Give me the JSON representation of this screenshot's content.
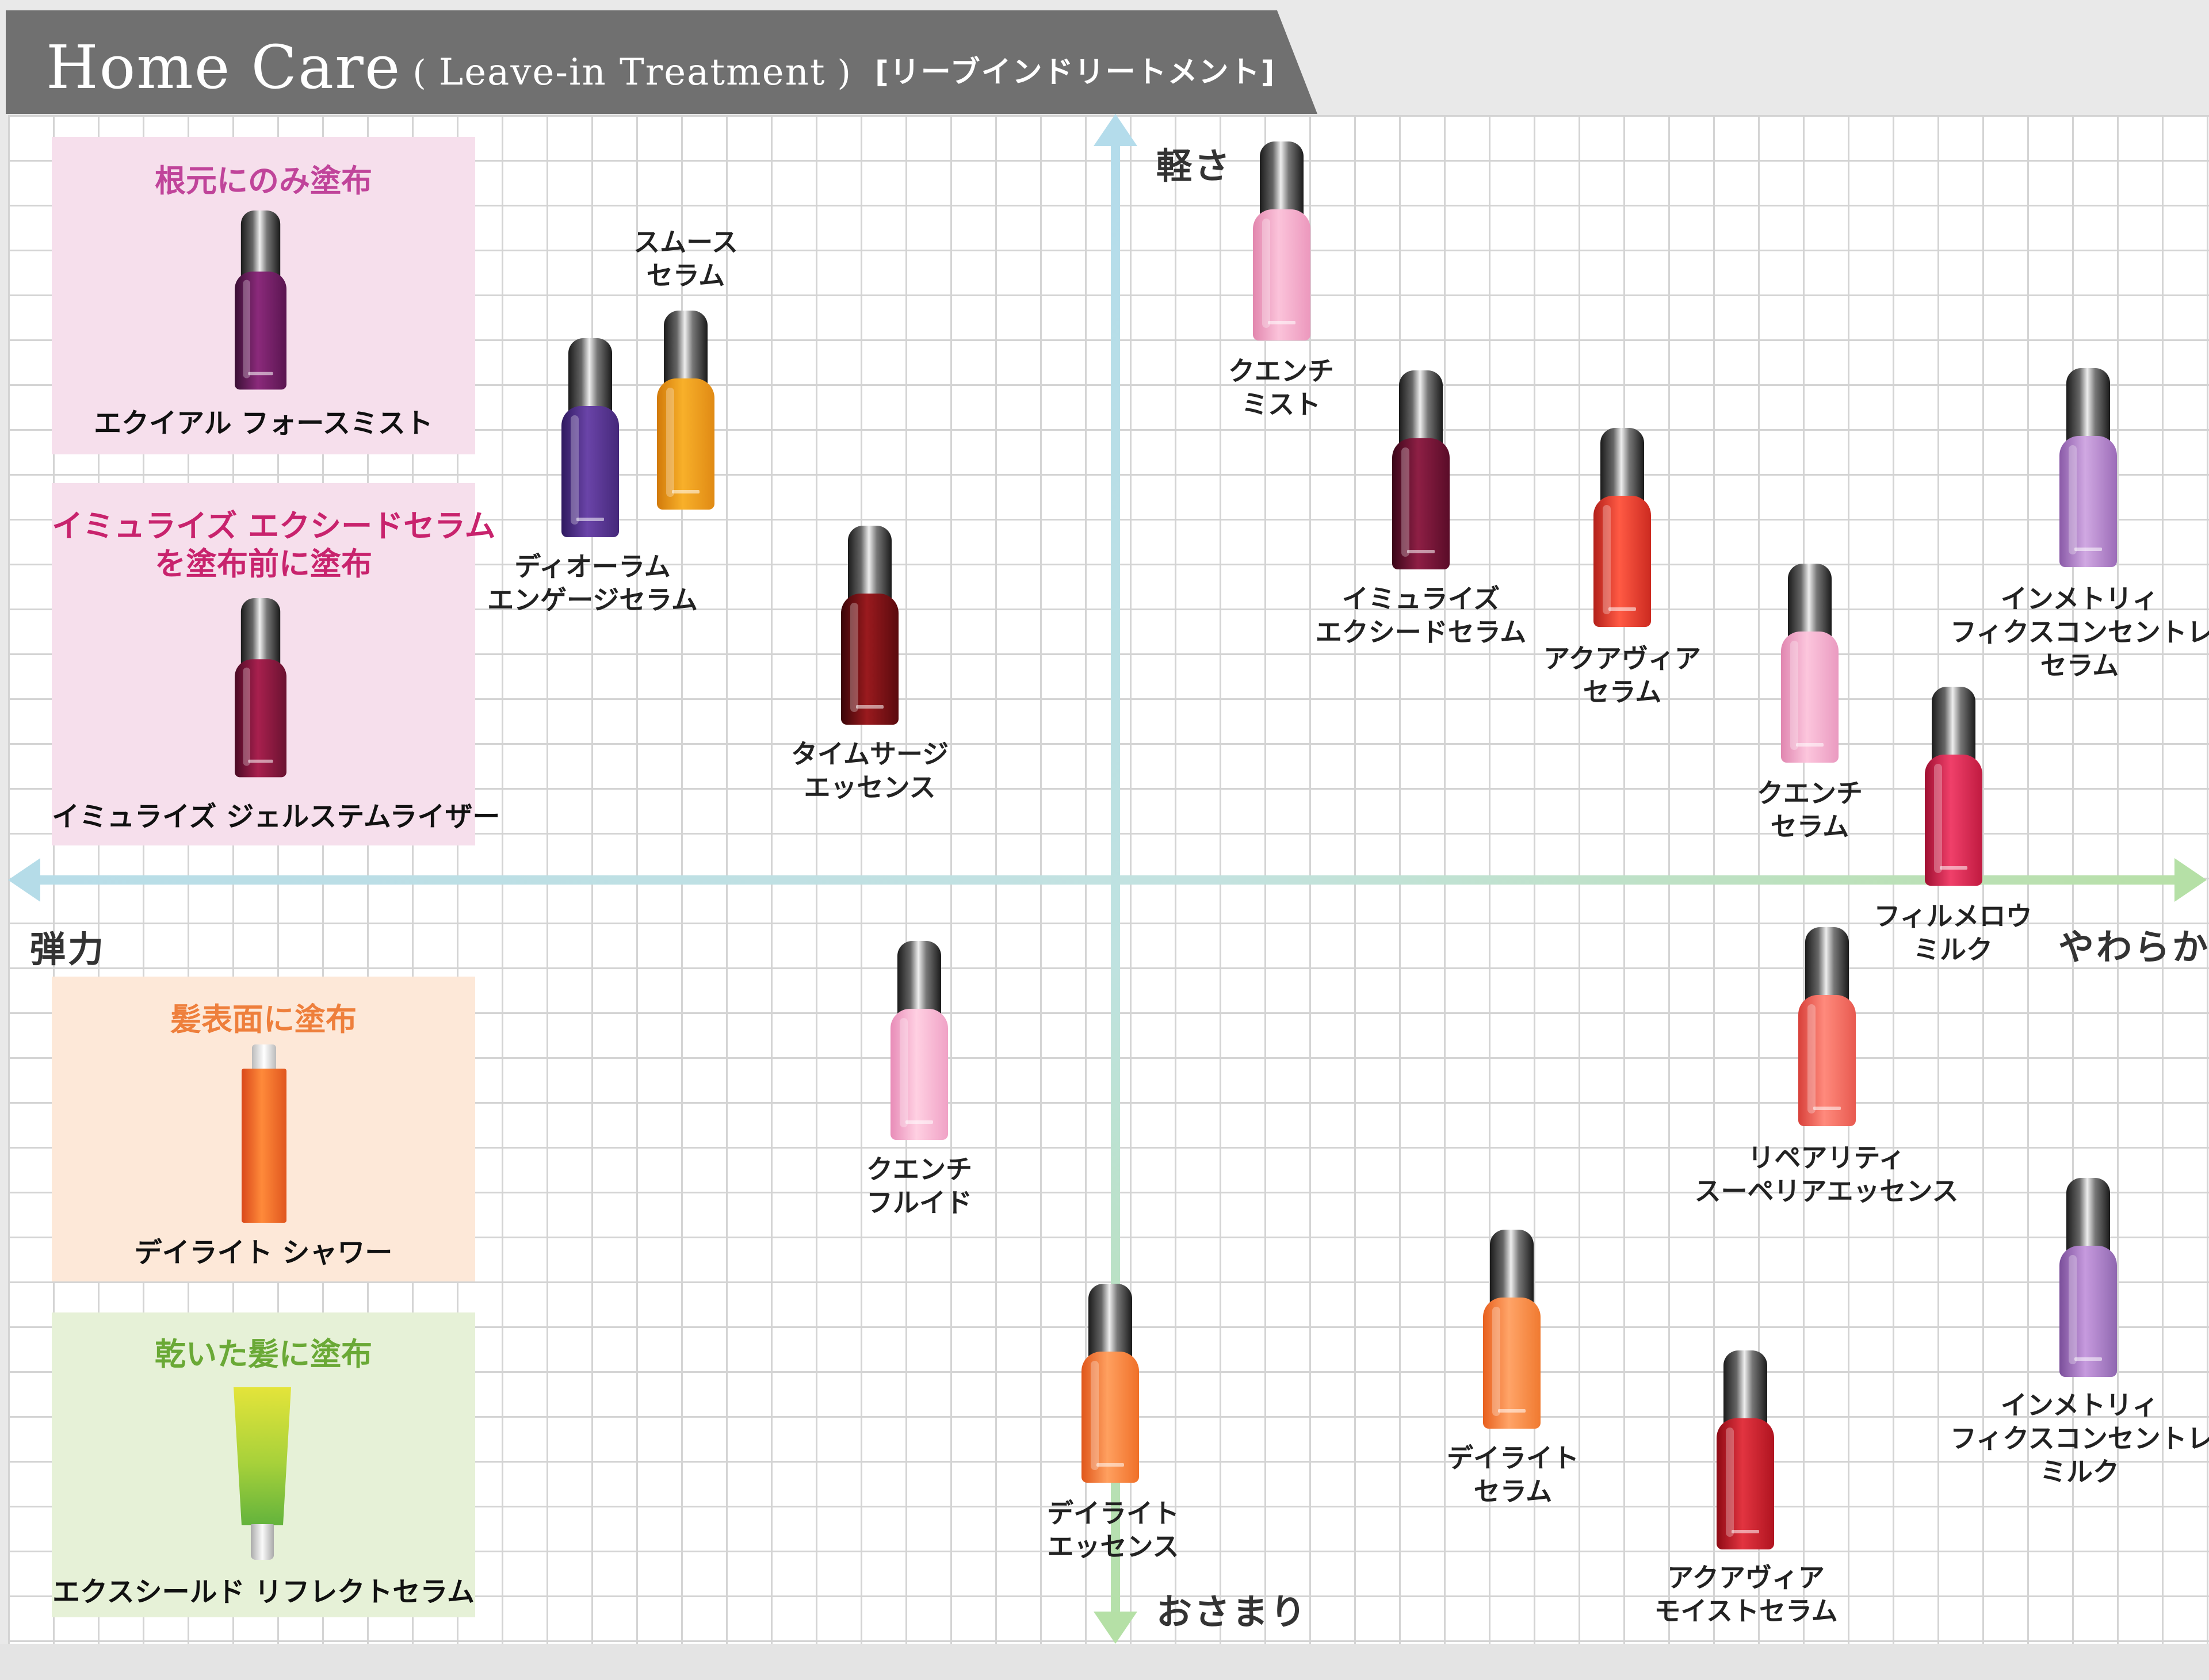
{
  "header": {
    "title": "Home Care",
    "paren_open": "(",
    "subtitle": "Leave-in Treatment",
    "paren_close": ")",
    "subtitle_jp": "[リーブインドリートメント]"
  },
  "axes": {
    "top": "軽さ",
    "bottom": "おさまり",
    "left": "弾力",
    "right": "やわらか"
  },
  "legend": [
    {
      "title": "根元にのみ塗布",
      "title_color": "#c0449a",
      "bg": "#f6dfec",
      "caption": "エクイアル フォースミスト"
    },
    {
      "title_line1": "イミュライズ エクシードセラム",
      "title_line2": "を塗布前に塗布",
      "title_color": "#c8236d",
      "bg": "#f6dfec",
      "caption": "イミュライズ ジェルステムライザー"
    },
    {
      "title": "髪表面に塗布",
      "title_color": "#ee7f3c",
      "bg": "#fde8d8",
      "caption": "デイライト シャワー"
    },
    {
      "title": "乾いた髪に塗布",
      "title_color": "#6aa936",
      "bg": "#e6f1d7",
      "caption": "エクスシールド リフレクトセラム"
    }
  ],
  "products": [
    {
      "lines": [
        "スムース",
        "セラム"
      ],
      "color": "#f2a31e"
    },
    {
      "lines": [
        "ディオーラム",
        "エンゲージセラム"
      ],
      "color": "#5a3590"
    },
    {
      "lines": [
        "タイムサージ",
        "エッセンス"
      ],
      "color": "#7a1015"
    },
    {
      "lines": [
        "クエンチ",
        "ミスト"
      ],
      "color": "#f2a0c4"
    },
    {
      "lines": [
        "イミュライズ",
        "エクシードセラム"
      ],
      "color": "#6e1230"
    },
    {
      "lines": [
        "アクアヴィア",
        "セラム"
      ],
      "color": "#e0392b"
    },
    {
      "lines": [
        "インメトリィ",
        "フィクスコンセントレー",
        "セラム"
      ],
      "color": "#b48ac8"
    },
    {
      "lines": [
        "クエンチ",
        "セラム"
      ],
      "color": "#f3a6c8"
    },
    {
      "lines": [
        "フィルメロウ",
        "ミルク"
      ],
      "color": "#d61e45"
    },
    {
      "lines": [
        "クエンチ",
        "フルイド"
      ],
      "color": "#f5a8c8"
    },
    {
      "lines": [
        "リペアリティ",
        "スーペリアエッセンス"
      ],
      "color": "#ec5a50"
    },
    {
      "lines": [
        "デイライト",
        "エッセンス"
      ],
      "color": "#f5792a"
    },
    {
      "lines": [
        "デイライト",
        "セラム"
      ],
      "color": "#f58030"
    },
    {
      "lines": [
        "アクアヴィア",
        "モイストセラム"
      ],
      "color": "#c81d28"
    },
    {
      "lines": [
        "インメトリィ",
        "フィクスコンセントレー",
        "ミルク"
      ],
      "color": "#a078bc"
    }
  ]
}
